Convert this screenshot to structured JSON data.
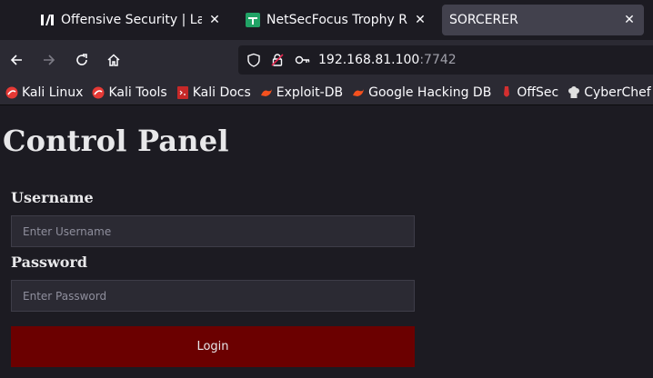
{
  "tabs": [
    {
      "title": "Offensive Security | Labs |",
      "favicon": "offsec-icon",
      "active": false
    },
    {
      "title": "NetSecFocus Trophy Room",
      "favicon": "sheets-icon",
      "active": false
    },
    {
      "title": "SORCERER",
      "favicon": "",
      "active": true
    }
  ],
  "address": {
    "host": "192.168.81.100",
    "port": ":7742"
  },
  "bookmarks": [
    {
      "label": "Kali Linux",
      "icon": "kali-icon"
    },
    {
      "label": "Kali Tools",
      "icon": "kali-icon"
    },
    {
      "label": "Kali Docs",
      "icon": "kali-docs-icon"
    },
    {
      "label": "Exploit-DB",
      "icon": "exploit-db-icon"
    },
    {
      "label": "Google Hacking DB",
      "icon": "ghdb-icon"
    },
    {
      "label": "OffSec",
      "icon": "offsec-icon"
    },
    {
      "label": "CyberChef",
      "icon": "cyberchef-icon"
    }
  ],
  "page": {
    "heading": "Control Panel",
    "username_label": "Username",
    "username_placeholder": "Enter Username",
    "password_label": "Password",
    "password_placeholder": "Enter Password",
    "login_label": "Login"
  },
  "colors": {
    "login_button": "#6b0000",
    "background": "#1c1b22",
    "sheets_green": "#21a366",
    "kali_red": "#e53935"
  }
}
